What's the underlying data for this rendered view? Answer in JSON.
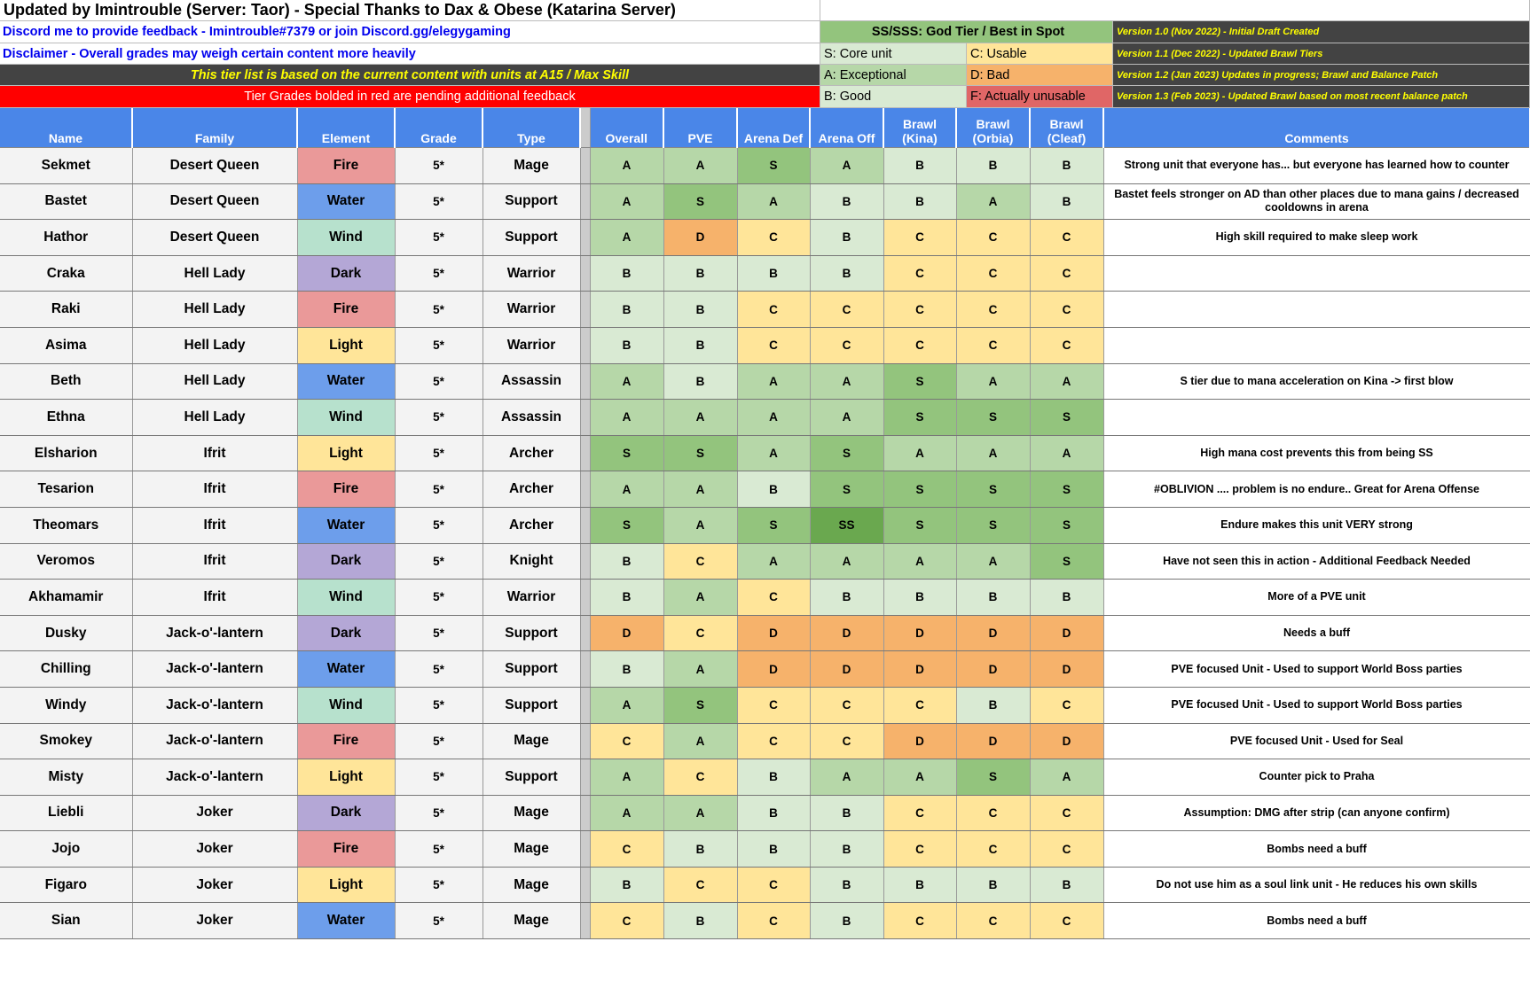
{
  "header": {
    "title": "Updated by Imintrouble (Server: Taor) - Special Thanks to Dax & Obese (Katarina Server)",
    "feedback": "Discord me to provide feedback - Imintrouble#7379 or join Discord.gg/elegygaming",
    "disclaimer": "Disclaimer - Overall grades may weigh certain content more heavily",
    "content_note": "This tier list is based on the current content with units at A15 / Max Skill",
    "pending_note": "Tier Grades bolded in red are pending additional feedback"
  },
  "legend": {
    "ss": "SS/SSS: God Tier / Best in Spot",
    "s": "S: Core unit",
    "c": "C: Usable",
    "a": "A: Exceptional",
    "d": "D: Bad",
    "b": "B: Good",
    "f": "F: Actually unusable"
  },
  "versions": [
    "Version 1.0 (Nov 2022) - Initial Draft Created",
    "Version 1.1 (Dec 2022) - Updated Brawl Tiers",
    "Version 1.2 (Jan 2023) Updates in progress; Brawl and Balance Patch",
    "Version 1.3 (Feb 2023) - Updated Brawl based on most recent balance patch"
  ],
  "columns": [
    "Name",
    "Family",
    "Element",
    "Grade",
    "Type",
    "",
    "Overall",
    "PVE",
    "Arena Def",
    "Arena Off",
    "Brawl (Kina)",
    "Brawl (Orbia)",
    "Brawl (Cleaf)",
    "Comments"
  ],
  "colors": {
    "header_blue": "#4a86e8",
    "Fire": "#ea9999",
    "Water": "#6d9eeb",
    "Wind": "#b7e1cd",
    "Dark": "#b4a7d6",
    "Light": "#ffe599",
    "SS": "#6aa84f",
    "S": "#93c47d",
    "A": "#b6d7a8",
    "B": "#d9ead3",
    "C": "#ffe599",
    "D": "#f6b26b",
    "F": "#e06666"
  },
  "rows": [
    {
      "name": "Sekmet",
      "family": "Desert Queen",
      "element": "Fire",
      "grade": "5*",
      "type": "Mage",
      "tiers": [
        "A",
        "A",
        "S",
        "A",
        "B",
        "B",
        "B"
      ],
      "comment": "Strong unit that everyone has... but everyone has learned how to counter"
    },
    {
      "name": "Bastet",
      "family": "Desert Queen",
      "element": "Water",
      "grade": "5*",
      "type": "Support",
      "tiers": [
        "A",
        "S",
        "A",
        "B",
        "B",
        "A",
        "B"
      ],
      "comment": "Bastet feels stronger on AD than other places due to mana gains / decreased cooldowns in arena"
    },
    {
      "name": "Hathor",
      "family": "Desert Queen",
      "element": "Wind",
      "grade": "5*",
      "type": "Support",
      "tiers": [
        "A",
        "D",
        "C",
        "B",
        "C",
        "C",
        "C"
      ],
      "comment": "High skill required to make sleep work"
    },
    {
      "name": "Craka",
      "family": "Hell Lady",
      "element": "Dark",
      "grade": "5*",
      "type": "Warrior",
      "tiers": [
        "B",
        "B",
        "B",
        "B",
        "C",
        "C",
        "C"
      ],
      "comment": ""
    },
    {
      "name": "Raki",
      "family": "Hell Lady",
      "element": "Fire",
      "grade": "5*",
      "type": "Warrior",
      "tiers": [
        "B",
        "B",
        "C",
        "C",
        "C",
        "C",
        "C"
      ],
      "comment": ""
    },
    {
      "name": "Asima",
      "family": "Hell Lady",
      "element": "Light",
      "grade": "5*",
      "type": "Warrior",
      "tiers": [
        "B",
        "B",
        "C",
        "C",
        "C",
        "C",
        "C"
      ],
      "comment": ""
    },
    {
      "name": "Beth",
      "family": "Hell Lady",
      "element": "Water",
      "grade": "5*",
      "type": "Assassin",
      "tiers": [
        "A",
        "B",
        "A",
        "A",
        "S",
        "A",
        "A"
      ],
      "comment": "S tier due to mana acceleration on Kina -> first blow"
    },
    {
      "name": "Ethna",
      "family": "Hell Lady",
      "element": "Wind",
      "grade": "5*",
      "type": "Assassin",
      "tiers": [
        "A",
        "A",
        "A",
        "A",
        "S",
        "S",
        "S"
      ],
      "comment": ""
    },
    {
      "name": "Elsharion",
      "family": "Ifrit",
      "element": "Light",
      "grade": "5*",
      "type": "Archer",
      "tiers": [
        "S",
        "S",
        "A",
        "S",
        "A",
        "A",
        "A"
      ],
      "comment": "High mana cost prevents this from being SS"
    },
    {
      "name": "Tesarion",
      "family": "Ifrit",
      "element": "Fire",
      "grade": "5*",
      "type": "Archer",
      "tiers": [
        "A",
        "A",
        "B",
        "S",
        "S",
        "S",
        "S"
      ],
      "comment": "#OBLIVION .... problem is no endure.. Great for Arena Offense"
    },
    {
      "name": "Theomars",
      "family": "Ifrit",
      "element": "Water",
      "grade": "5*",
      "type": "Archer",
      "tiers": [
        "S",
        "A",
        "S",
        "SS",
        "S",
        "S",
        "S"
      ],
      "comment": "Endure makes this unit VERY strong"
    },
    {
      "name": "Veromos",
      "family": "Ifrit",
      "element": "Dark",
      "grade": "5*",
      "type": "Knight",
      "tiers": [
        "B",
        "C",
        "A",
        "A",
        "A",
        "A",
        "S"
      ],
      "comment": "Have not seen this in action -  Additional Feedback Needed"
    },
    {
      "name": "Akhamamir",
      "family": "Ifrit",
      "element": "Wind",
      "grade": "5*",
      "type": "Warrior",
      "tiers": [
        "B",
        "A",
        "C",
        "B",
        "B",
        "B",
        "B"
      ],
      "comment": "More of a PVE unit"
    },
    {
      "name": "Dusky",
      "family": "Jack-o'-lantern",
      "element": "Dark",
      "grade": "5*",
      "type": "Support",
      "tiers": [
        "D",
        "C",
        "D",
        "D",
        "D",
        "D",
        "D"
      ],
      "comment": "Needs a buff"
    },
    {
      "name": "Chilling",
      "family": "Jack-o'-lantern",
      "element": "Water",
      "grade": "5*",
      "type": "Support",
      "tiers": [
        "B",
        "A",
        "D",
        "D",
        "D",
        "D",
        "D"
      ],
      "comment": "PVE focused Unit - Used to support World Boss parties"
    },
    {
      "name": "Windy",
      "family": "Jack-o'-lantern",
      "element": "Wind",
      "grade": "5*",
      "type": "Support",
      "tiers": [
        "A",
        "S",
        "C",
        "C",
        "C",
        "B",
        "C"
      ],
      "comment": "PVE focused Unit - Used to support World Boss parties"
    },
    {
      "name": "Smokey",
      "family": "Jack-o'-lantern",
      "element": "Fire",
      "grade": "5*",
      "type": "Mage",
      "tiers": [
        "C",
        "A",
        "C",
        "C",
        "D",
        "D",
        "D"
      ],
      "comment": "PVE focused Unit - Used for Seal"
    },
    {
      "name": "Misty",
      "family": "Jack-o'-lantern",
      "element": "Light",
      "grade": "5*",
      "type": "Support",
      "tiers": [
        "A",
        "C",
        "B",
        "A",
        "A",
        "S",
        "A"
      ],
      "comment": "Counter pick to Praha"
    },
    {
      "name": "Liebli",
      "family": "Joker",
      "element": "Dark",
      "grade": "5*",
      "type": "Mage",
      "tiers": [
        "A",
        "A",
        "B",
        "B",
        "C",
        "C",
        "C"
      ],
      "comment": "Assumption: DMG after strip (can anyone confirm)"
    },
    {
      "name": "Jojo",
      "family": "Joker",
      "element": "Fire",
      "grade": "5*",
      "type": "Mage",
      "tiers": [
        "C",
        "B",
        "B",
        "B",
        "C",
        "C",
        "C"
      ],
      "comment": "Bombs need a buff"
    },
    {
      "name": "Figaro",
      "family": "Joker",
      "element": "Light",
      "grade": "5*",
      "type": "Mage",
      "tiers": [
        "B",
        "C",
        "C",
        "B",
        "B",
        "B",
        "B"
      ],
      "comment": "Do not use him as a soul link unit - He reduces his own skills"
    },
    {
      "name": "Sian",
      "family": "Joker",
      "element": "Water",
      "grade": "5*",
      "type": "Mage",
      "tiers": [
        "C",
        "B",
        "C",
        "B",
        "C",
        "C",
        "C"
      ],
      "comment": "Bombs need a buff"
    }
  ]
}
